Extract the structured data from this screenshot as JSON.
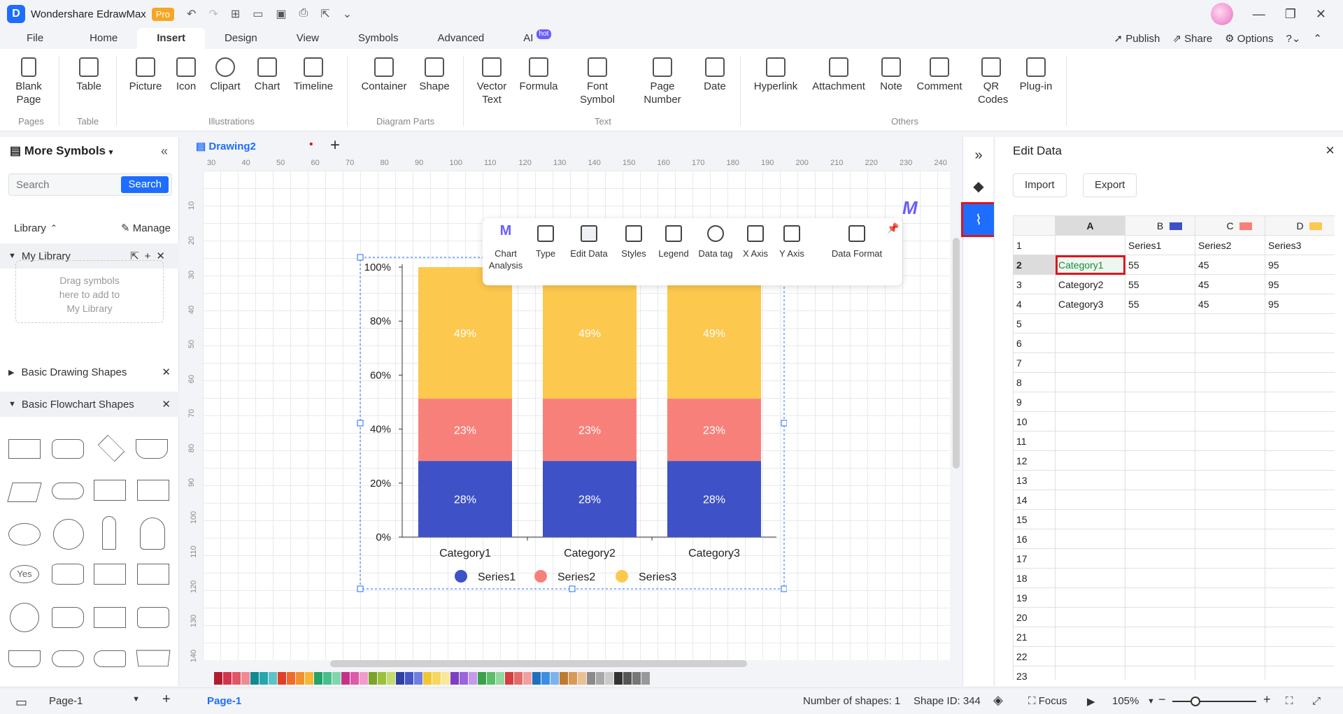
{
  "app": {
    "title": "Wondershare EdrawMax",
    "badge": "Pro"
  },
  "menu": {
    "items": [
      "File",
      "Home",
      "Insert",
      "Design",
      "View",
      "Symbols",
      "Advanced",
      "AI"
    ],
    "active": "Insert",
    "ai_badge": "hot",
    "right": {
      "publish": "Publish",
      "share": "Share",
      "options": "Options"
    }
  },
  "ribbon": {
    "buttons": [
      {
        "id": "blank-page",
        "label": "Blank\nPage",
        "line1": "Blank",
        "line2": "Page"
      },
      {
        "id": "table",
        "label": "Table"
      },
      {
        "id": "picture",
        "label": "Picture"
      },
      {
        "id": "icon",
        "label": "Icon"
      },
      {
        "id": "clipart",
        "label": "Clipart"
      },
      {
        "id": "chart",
        "label": "Chart"
      },
      {
        "id": "timeline",
        "label": "Timeline"
      },
      {
        "id": "container",
        "label": "Container"
      },
      {
        "id": "shape",
        "label": "Shape"
      },
      {
        "id": "vector-text",
        "line1": "Vector",
        "line2": "Text"
      },
      {
        "id": "formula",
        "label": "Formula"
      },
      {
        "id": "font-symbol",
        "line1": "Font",
        "line2": "Symbol"
      },
      {
        "id": "page-number",
        "line1": "Page",
        "line2": "Number"
      },
      {
        "id": "date",
        "label": "Date"
      },
      {
        "id": "hyperlink",
        "label": "Hyperlink"
      },
      {
        "id": "attachment",
        "label": "Attachment"
      },
      {
        "id": "note",
        "label": "Note"
      },
      {
        "id": "comment",
        "label": "Comment"
      },
      {
        "id": "qr-codes",
        "line1": "QR",
        "line2": "Codes"
      },
      {
        "id": "plug-in",
        "label": "Plug-in"
      }
    ],
    "groups": [
      "Pages",
      "Table",
      "Illustrations",
      "Diagram Parts",
      "Text",
      "Others"
    ]
  },
  "left_panel": {
    "title": "More Symbols",
    "search_placeholder": "Search",
    "search_button": "Search",
    "library": "Library",
    "manage": "Manage",
    "my_library": "My Library",
    "drop_hint": "Drag symbols here to add to My Library",
    "drop_hint_lines": [
      "Drag symbols",
      "here to add to",
      "My Library"
    ],
    "sections": [
      "Basic Drawing Shapes",
      "Basic Flowchart Shapes"
    ],
    "yes_shape": "Yes"
  },
  "canvas": {
    "tab": "Drawing2",
    "ruler_top": [
      "30",
      "40",
      "50",
      "60",
      "70",
      "80",
      "90",
      "100",
      "110",
      "120",
      "130",
      "140",
      "150",
      "160",
      "170",
      "180",
      "190",
      "200",
      "210",
      "220",
      "230",
      "240"
    ],
    "ruler_left": [
      "10",
      "20",
      "30",
      "40",
      "50",
      "60",
      "70",
      "80",
      "90",
      "100",
      "110",
      "120",
      "130",
      "140"
    ]
  },
  "chart_toolbar": {
    "items": [
      "Chart\nAnalysis",
      "Type",
      "Edit Data",
      "Styles",
      "Legend",
      "Data tag",
      "X Axis",
      "Y Axis",
      "Data Format"
    ],
    "chart_analysis": [
      "Chart",
      "Analysis"
    ]
  },
  "chart_data": {
    "type": "bar",
    "stacked": "percent",
    "categories": [
      "Category1",
      "Category2",
      "Category3"
    ],
    "series": [
      {
        "name": "Series1",
        "values": [
          55,
          55,
          55
        ],
        "color": "#3f51c6",
        "label": "28%"
      },
      {
        "name": "Series2",
        "values": [
          45,
          45,
          45
        ],
        "color": "#f7817a",
        "label": "23%"
      },
      {
        "name": "Series3",
        "values": [
          95,
          95,
          95
        ],
        "color": "#fcc84e",
        "label": "49%"
      }
    ],
    "y_ticks": [
      "0%",
      "20%",
      "40%",
      "60%",
      "80%",
      "100%"
    ],
    "ylim": [
      0,
      100
    ],
    "legend_position": "bottom"
  },
  "edit_data": {
    "title": "Edit Data",
    "import": "Import",
    "export": "Export",
    "columns": [
      "A",
      "B",
      "C",
      "D"
    ],
    "col_colors": [
      "",
      "#3f51c6",
      "#f7817a",
      "#fcc84e"
    ],
    "rows": [
      [
        "",
        "Series1",
        "Series2",
        "Series3"
      ],
      [
        "Category1",
        "55",
        "45",
        "95"
      ],
      [
        "Category2",
        "55",
        "45",
        "95"
      ],
      [
        "Category3",
        "55",
        "45",
        "95"
      ]
    ],
    "row_numbers": [
      "1",
      "2",
      "3",
      "4",
      "5",
      "6",
      "7",
      "8",
      "9",
      "10",
      "11",
      "12",
      "13",
      "14",
      "15",
      "16",
      "17",
      "18",
      "19",
      "20",
      "21",
      "22",
      "23"
    ],
    "selected_row": "2"
  },
  "status": {
    "page_selector": "Page-1",
    "page_tab": "Page-1",
    "shape_count": "Number of shapes: 1",
    "shape_id": "Shape ID: 344",
    "focus": "Focus",
    "zoom": "105%"
  }
}
